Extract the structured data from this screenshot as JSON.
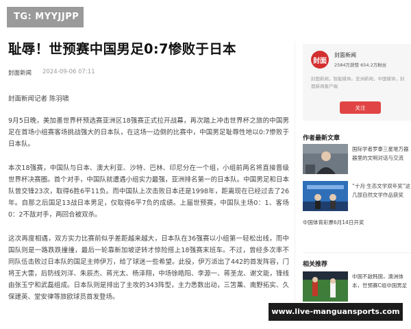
{
  "tag": "TG: MYYJJPP",
  "banner": "www.live-manguansports.com",
  "article": {
    "title": "耻辱！世预赛中国男足0:7惨败于日本",
    "source": "封面新闻",
    "date": "2024-09-06 07:11",
    "reporter": "封面新闻记者 陈羽啸",
    "paragraphs": [
      "9月5日晚，美加墨世界杯预选赛亚洲区18强赛正式拉开战幕，再次踏上冲击世界杯之旅的中国男足在首场小组赛客场挑战强大的日本队，在这场一边倒的比赛中，中国男足耻辱性地以0:7惨败于日本队。",
      "本次18强赛，中国队与日本、澳大利亚、沙特、巴林、印尼分在一个组，小组前两名将直接晋级世界杯决赛圈。首个对手，中国队就遭遇小组实力最强，亚洲排名第一的日本队。中国男足和日本队曾交锋23次，取得6胜6平11负。而中国队上次击败日本还是1998年，距离现在已经过去了26年。自那之后国足13战日本男足，仅取得6平7负的成绩。上届世预赛，中国队主场0：1、客场0：2不敌对手，两回合被双杀。",
      "这次再度相遇，双方实力比赛前似乎差距越来越大，日本队在36强赛以小组第一轻松出线，而中国队则是一路跌跌撞撞，最后一轮靠新加坡逆转才惊险搭上18强赛末班车。不过，曾经多次率不同队伍击败过日本队的国足主帅伊万，给了球迷一些希望。此役，伊万派出了442的首发阵容，门将王大雷，后防线刘洋、朱辰杰、蒋光太、杨泽翔，中场徐皓阳、李源一、蒋圣龙、谢文能，锋线由张玉宁和武磊组成。日本队则是排出了主攻的343阵型，主力悉数出动，三笘薰、南野拓实、久保建英、堂安律等旅欧球员首发登场。"
    ]
  },
  "sidebar": {
    "card": {
      "logo": "封面",
      "name": "封面新闻",
      "stats": "2584万获赞 654.2万粉丝",
      "desc": "封面新闻，智能媒体。亚洲新闻，中国媒体，封面新闻客户端",
      "follow": "关注"
    },
    "author_title": "作者最新文章",
    "author_items": [
      "国际学者罗泰三星堆万器器里的文明对话与交流",
      "“十月·生态文学双年奖”这几部自然文学作品获奖",
      "中国体育彩票6月14日开奖"
    ],
    "related_title": "相关推荐",
    "related_items": [
      "中国不敌韩国，澳洲体本，世预赛C组中国男足"
    ]
  }
}
